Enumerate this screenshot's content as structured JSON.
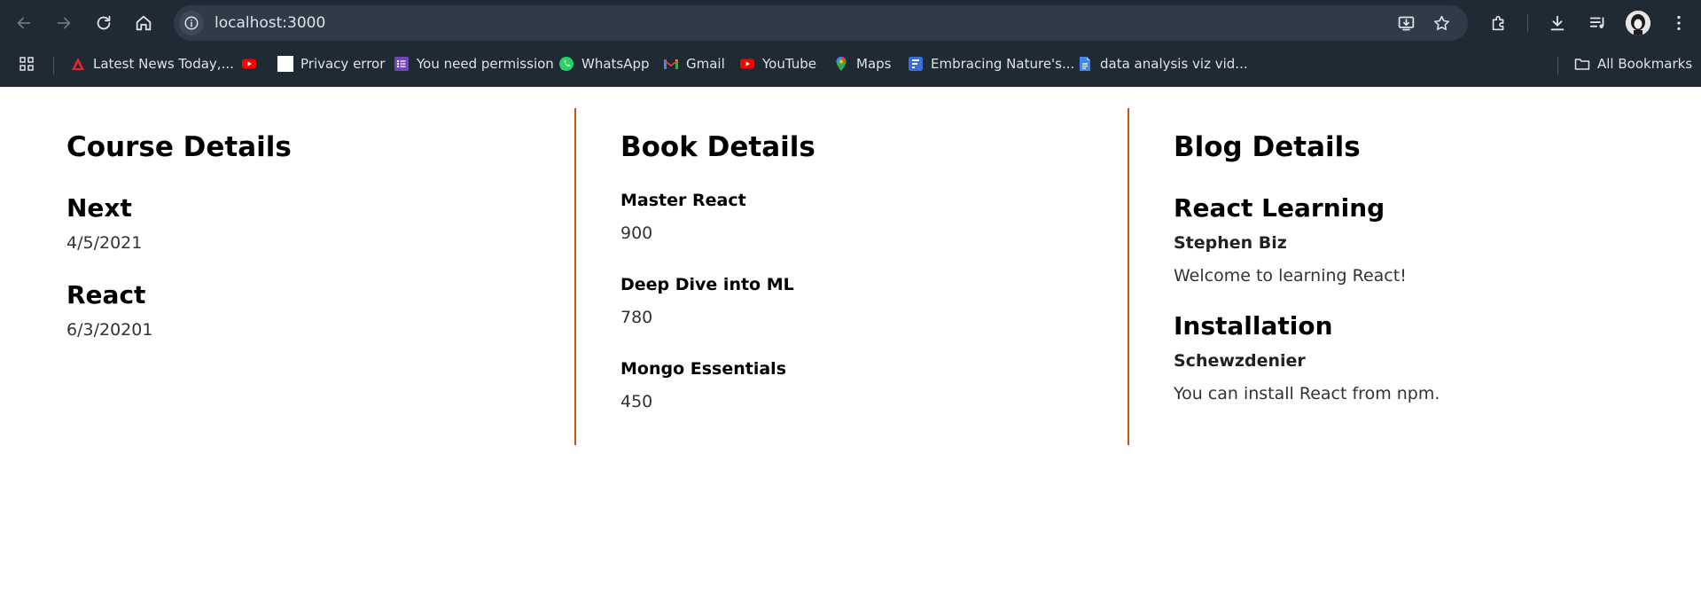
{
  "browser": {
    "url": "localhost:3000",
    "bookmarks": [
      {
        "label": "Latest News Today,...",
        "icon": "news-logo-icon"
      },
      {
        "label": "",
        "icon": "youtube-icon"
      },
      {
        "label": "Privacy error",
        "icon": "blank-page-icon"
      },
      {
        "label": "You need permission",
        "icon": "forms-icon"
      },
      {
        "label": "WhatsApp",
        "icon": "whatsapp-icon"
      },
      {
        "label": "Gmail",
        "icon": "gmail-icon"
      },
      {
        "label": "YouTube",
        "icon": "youtube-icon"
      },
      {
        "label": "Maps",
        "icon": "maps-pin-icon"
      },
      {
        "label": "Embracing Nature's...",
        "icon": "docs-blue-icon"
      },
      {
        "label": "data analysis viz vid...",
        "icon": "docs-icon"
      }
    ],
    "all_bookmarks_label": "All Bookmarks"
  },
  "colors": {
    "divider": "#d35400",
    "chrome_bg": "#202a35",
    "omnibox_bg": "#2f3b48"
  },
  "course": {
    "title": "Course Details",
    "items": [
      {
        "name": "Next",
        "date": "4/5/2021"
      },
      {
        "name": "React",
        "date": "6/3/20201"
      }
    ]
  },
  "book": {
    "title": "Book Details",
    "items": [
      {
        "name": "Master React",
        "price": "900"
      },
      {
        "name": "Deep Dive into ML",
        "price": "780"
      },
      {
        "name": "Mongo Essentials",
        "price": "450"
      }
    ]
  },
  "blog": {
    "title": "Blog Details",
    "items": [
      {
        "title": "React Learning",
        "author": "Stephen Biz",
        "content": "Welcome to learning React!"
      },
      {
        "title": "Installation",
        "author": "Schewzdenier",
        "content": "You can install React from npm."
      }
    ]
  }
}
